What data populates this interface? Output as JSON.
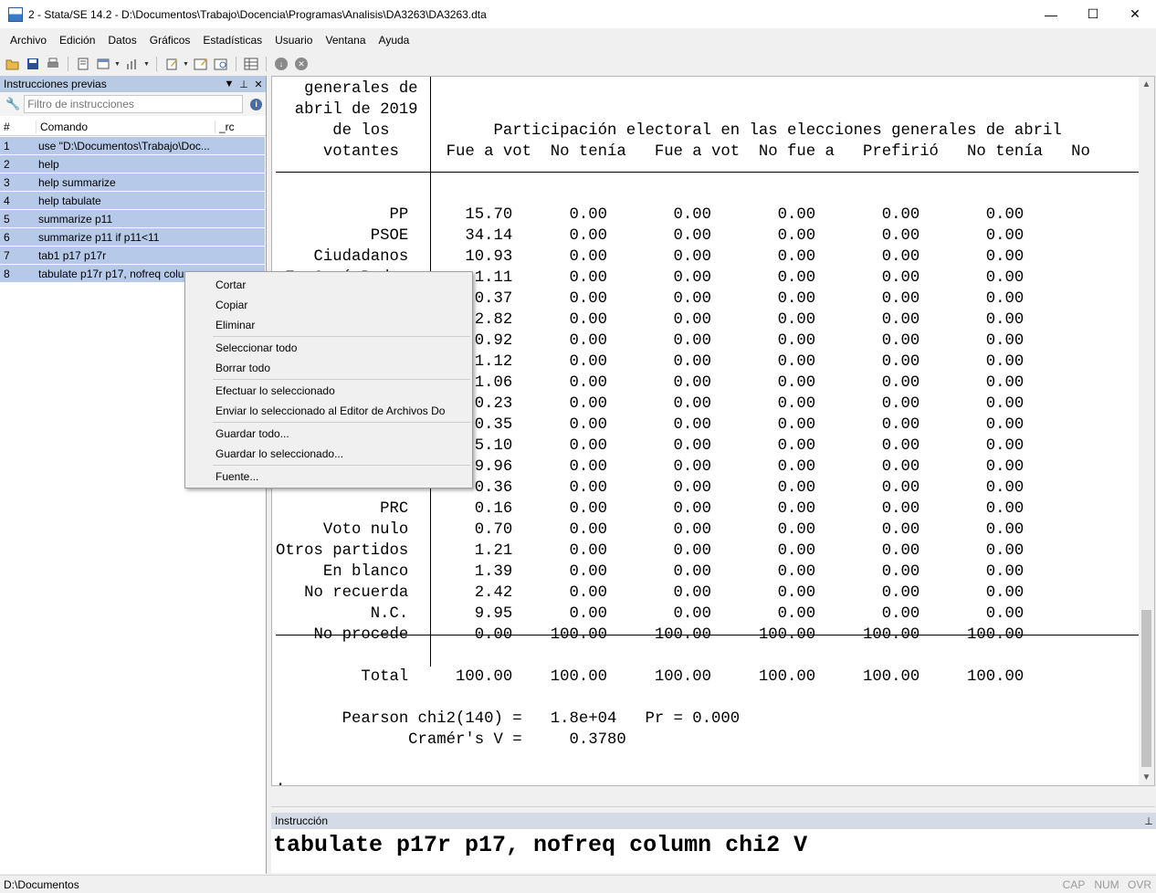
{
  "window": {
    "title": "2 - Stata/SE 14.2 - D:\\Documentos\\Trabajo\\Docencia\\Programas\\Analisis\\DA3263\\DA3263.dta",
    "controls": [
      "—",
      "☐",
      "✕"
    ]
  },
  "menubar": [
    "Archivo",
    "Edición",
    "Datos",
    "Gráficos",
    "Estadísticas",
    "Usuario",
    "Ventana",
    "Ayuda"
  ],
  "toolbar": {
    "icons": [
      "open-icon",
      "save-icon",
      "print-icon",
      "log-icon",
      "viewer-icon",
      "graph-icon",
      "do-editor-icon",
      "data-editor-icon",
      "data-browser-icon",
      "variables-manager-icon",
      "more-icon",
      "break-icon"
    ]
  },
  "history": {
    "title": "Instrucciones previas",
    "filter_placeholder": "Filtro de instrucciones",
    "columns": [
      "#",
      "Comando",
      "_rc"
    ],
    "rows": [
      {
        "n": "1",
        "cmd": "use \"D:\\Documentos\\Trabajo\\Doc..."
      },
      {
        "n": "2",
        "cmd": "help"
      },
      {
        "n": "3",
        "cmd": "help summarize"
      },
      {
        "n": "4",
        "cmd": "help tabulate"
      },
      {
        "n": "5",
        "cmd": "summarize p11"
      },
      {
        "n": "6",
        "cmd": "summarize p11 if p11<11"
      },
      {
        "n": "7",
        "cmd": "tab1 p17 p17r"
      },
      {
        "n": "8",
        "cmd": "tabulate p17r p17, nofreq colu"
      }
    ]
  },
  "results": {
    "header_lines": [
      "   generales de",
      "  abril de 2019",
      "      de los           Participación electoral en las elecciones generales de abril",
      "     votantes     Fue a vot  No tenía   Fue a vot  No fue a   Prefirió   No tenía   No"
    ],
    "row_labels": [
      "PP",
      "PSOE",
      "Ciudadanos",
      "En Comú Podem",
      "",
      "",
      "",
      "",
      "",
      "",
      "",
      "",
      "",
      "",
      "PRC",
      "Voto nulo",
      "Otros partidos",
      "En blanco",
      "No recuerda",
      "N.C.",
      "No procede"
    ],
    "first_col": [
      "15.70",
      "34.14",
      "10.93",
      "1.11",
      "0.37",
      "2.82",
      "0.92",
      "1.12",
      "1.06",
      "0.23",
      "0.35",
      "5.10",
      "9.96",
      "0.36",
      "0.16",
      "0.70",
      "1.21",
      "1.39",
      "2.42",
      "9.95",
      "0.00"
    ],
    "other_cols_default": "0.00",
    "no_procede_other": "100.00",
    "total_label": "Total",
    "total_values": [
      "100.00",
      "100.00",
      "100.00",
      "100.00",
      "100.00",
      "100.00"
    ],
    "chi2_line": "Pearson chi2(140) =   1.8e+04   Pr = 0.000",
    "cramer_line": "Cramér's V =     0.3780",
    "prompt": "."
  },
  "command": {
    "title": "Instrucción",
    "text": "tabulate p17r p17, nofreq column chi2 V"
  },
  "status": {
    "path": "D:\\Documentos",
    "flags": [
      "CAP",
      "NUM",
      "OVR"
    ]
  },
  "context_menu": {
    "groups": [
      [
        "Cortar",
        "Copiar",
        "Eliminar"
      ],
      [
        "Seleccionar todo",
        "Borrar todo"
      ],
      [
        "Efectuar lo seleccionado",
        "Enviar lo seleccionado al Editor de Archivos Do"
      ],
      [
        "Guardar todo...",
        "Guardar lo seleccionado..."
      ],
      [
        "Fuente..."
      ]
    ]
  }
}
